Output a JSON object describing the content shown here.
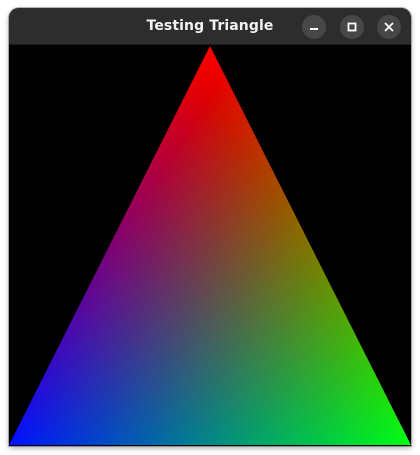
{
  "window": {
    "title": "Testing Triangle",
    "controls": {
      "minimize_icon": "minimize-icon",
      "maximize_icon": "maximize-icon",
      "close_icon": "close-icon"
    },
    "colors": {
      "titlebar": "#2d2d2d",
      "canvas_background": "#000000"
    }
  },
  "triangle": {
    "top_vertex_color": "#ff0000",
    "bottom_left_vertex_color": "#0000ff",
    "bottom_right_vertex_color": "#00ff00"
  }
}
